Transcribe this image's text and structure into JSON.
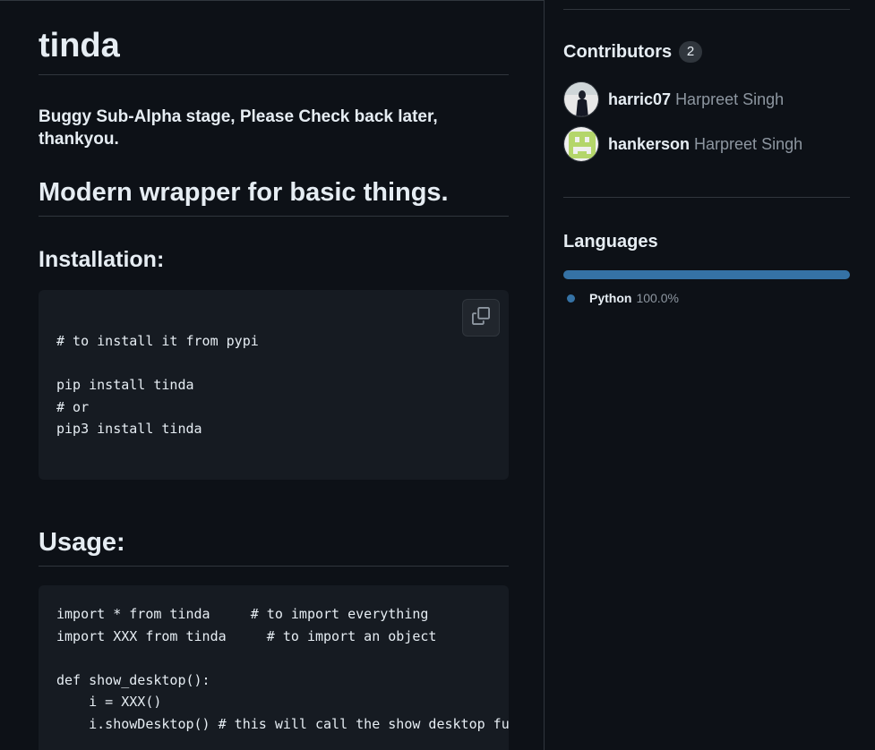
{
  "readme": {
    "title": "tinda",
    "intro": "Buggy Sub-Alpha stage, Please Check back later, thankyou.",
    "subtitle": "Modern wrapper for basic things.",
    "installation_heading": "Installation:",
    "installation_code": "# to install it from pypi\n\npip install tinda\n# or\npip3 install tinda",
    "usage_heading": "Usage:",
    "usage_code": "import * from tinda     # to import everything\nimport XXX from tinda     # to import an object\n\ndef show_desktop():\n    i = XXX()\n    i.showDesktop() # this will call the show desktop function"
  },
  "sidebar": {
    "contributors": {
      "title": "Contributors",
      "count": "2",
      "items": [
        {
          "login": "harric07",
          "name": "Harpreet Singh"
        },
        {
          "login": "hankerson",
          "name": "Harpreet Singh"
        }
      ]
    },
    "languages": {
      "title": "Languages",
      "items": [
        {
          "name": "Python",
          "percent_label": "100.0%",
          "fraction": 1.0,
          "color": "#3572A5"
        }
      ]
    }
  },
  "icons": {
    "copy": "copy-icon"
  }
}
